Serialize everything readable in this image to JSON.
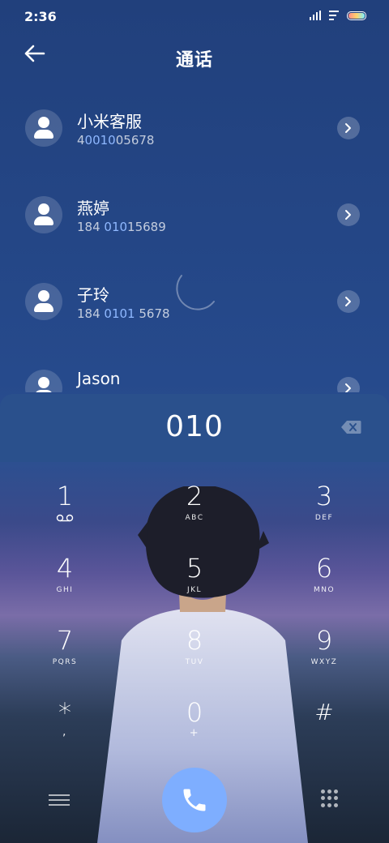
{
  "status_bar": {
    "time": "2:36"
  },
  "header": {
    "title": "通话"
  },
  "contacts": [
    {
      "name": "小米客服",
      "phone_pre": "4",
      "phone_hl": "0010",
      "phone_post": "05678"
    },
    {
      "name": "燕婷",
      "phone_pre": "184 ",
      "phone_hl": "010",
      "phone_post": "15689"
    },
    {
      "name": "子玲",
      "phone_pre": "184 ",
      "phone_hl": "0101",
      "phone_post": " 5678"
    },
    {
      "name": "Jason",
      "phone_pre": "",
      "phone_hl": "",
      "phone_post": ""
    }
  ],
  "dialer": {
    "input": "010"
  },
  "keypad": [
    {
      "digit": "1",
      "letters": ""
    },
    {
      "digit": "2",
      "letters": "ABC"
    },
    {
      "digit": "3",
      "letters": "DEF"
    },
    {
      "digit": "4",
      "letters": "GHI"
    },
    {
      "digit": "5",
      "letters": "JKL"
    },
    {
      "digit": "6",
      "letters": "MNO"
    },
    {
      "digit": "7",
      "letters": "PQRS"
    },
    {
      "digit": "8",
      "letters": "TUV"
    },
    {
      "digit": "9",
      "letters": "WXYZ"
    },
    {
      "digit": "*",
      "letters": ","
    },
    {
      "digit": "0",
      "letters": "+"
    },
    {
      "digit": "#",
      "letters": ""
    }
  ],
  "icons": {
    "back": "arrow-left-icon",
    "detail": "chevron-right-icon",
    "backspace": "backspace-icon",
    "call": "phone-icon",
    "menu": "menu-icon",
    "keypad": "dialpad-icon",
    "voicemail": "voicemail-icon"
  },
  "colors": {
    "accent": "#7eaeff",
    "highlight": "#8fb8ff"
  }
}
